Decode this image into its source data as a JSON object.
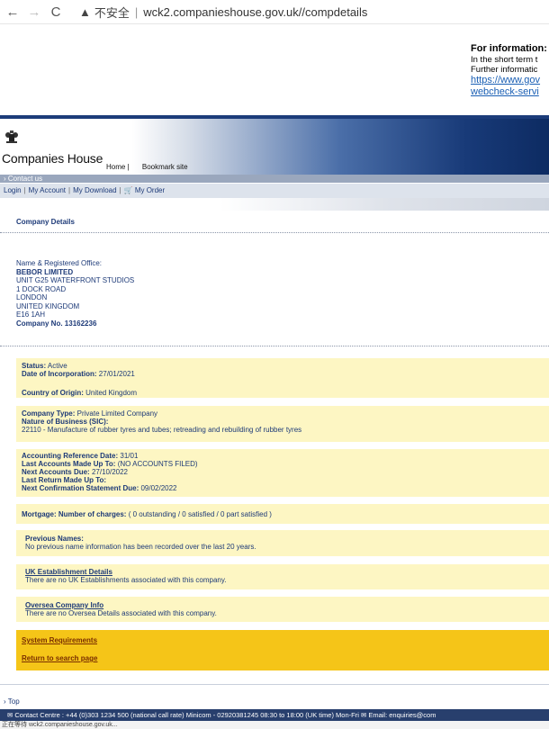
{
  "browser": {
    "back_icon": "←",
    "forward_icon": "→",
    "reload_icon": "C",
    "warning_icon": "▲",
    "insecure_label": "不安全",
    "separator": "|",
    "url": "wck2.companieshouse.gov.uk//compdetails"
  },
  "notice": {
    "title": "For information:",
    "line1": "In the short term t",
    "line2": "Further informatic",
    "link1": "https://www.gov",
    "link2": "webcheck-servi"
  },
  "header": {
    "brand": "Companies House",
    "home_link": "Home |",
    "bookmark_link": "Bookmark site"
  },
  "contact_bar": {
    "label": "› Contact us"
  },
  "login_bar": {
    "login": "Login",
    "account": "My Account",
    "download": "My Download",
    "order": "🛒 My Order",
    "divider": "|"
  },
  "page": {
    "title": "Company Details"
  },
  "company": {
    "office_label": "Name & Registered Office:",
    "name": "BEBOR LIMITED",
    "address_lines": [
      "UNIT G25 WATERFRONT STUDIOS",
      "1 DOCK ROAD",
      "LONDON",
      "UNITED KINGDOM",
      "E16 1AH"
    ],
    "number_label": "Company No.",
    "number": "13162236"
  },
  "status": {
    "status_label": "Status:",
    "status_value": "Active",
    "incorporation_label": "Date of Incorporation:",
    "incorporation_value": "27/01/2021",
    "country_label": "Country of Origin:",
    "country_value": "United Kingdom"
  },
  "type": {
    "type_label": "Company Type:",
    "type_value": "Private Limited Company",
    "nature_label": "Nature of Business (SIC):",
    "nature_value": "22110 - Manufacture of rubber tyres and tubes; retreading and rebuilding of rubber tyres"
  },
  "accounts": {
    "ref_label": "Accounting Reference Date:",
    "ref_value": "31/01",
    "last_label": "Last Accounts Made Up To:",
    "last_value": "(NO ACCOUNTS FILED)",
    "next_label": "Next Accounts Due:",
    "next_value": "27/10/2022",
    "return_label": "Last Return Made Up To:",
    "confirm_label": "Next Confirmation Statement Due:",
    "confirm_value": "09/02/2022"
  },
  "mortgage": {
    "label": "Mortgage: Number of charges:",
    "value": "( 0 outstanding / 0 satisfied / 0 part satisfied )"
  },
  "previous_names": {
    "label": "Previous Names:",
    "text": "No previous name information has been recorded over the last 20 years."
  },
  "uk_establishment": {
    "link": "UK Establishment Details",
    "text": "There are no UK Establishments associated with this company."
  },
  "oversea": {
    "link": "Oversea Company Info",
    "text": "There are no Oversea Details associated with this company."
  },
  "actions": {
    "system_requirements": "System Requirements",
    "return_search": "Return to search page"
  },
  "footer": {
    "top_link": "› Top",
    "contact": "✉  Contact Centre : +44 (0)303 1234 500 (national call rate)   Minicom - 02920381245 08:30 to 18:00 (UK time) Mon-Fri   ✉ Email: enquiries@com"
  },
  "status_bar": {
    "text": "正在等待 wck2.companieshouse.gov.uk..."
  }
}
